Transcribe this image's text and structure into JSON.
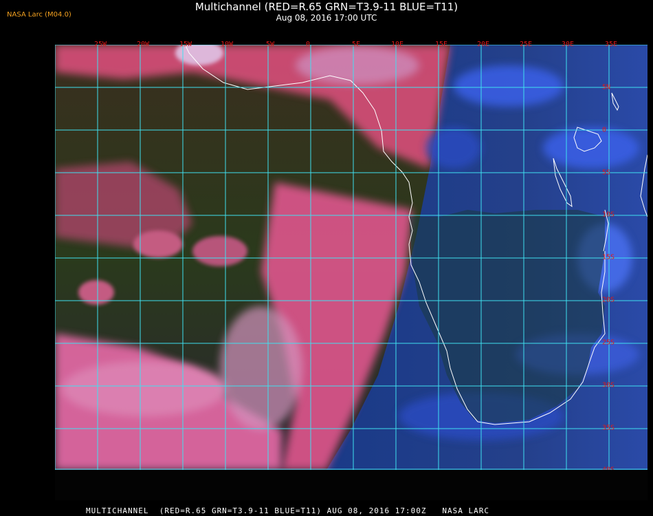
{
  "header": {
    "title": "Multichannel (RED=R.65 GRN=T3.9-11 BLUE=T11)",
    "datetime": "Aug 08, 2016 17:00 UTC"
  },
  "source_label": "NASA Larc (M04.0)",
  "map": {
    "type": "satellite multichannel RGB composite",
    "lon_labels": [
      "25W",
      "20W",
      "15W",
      "10W",
      "5W",
      "0",
      "5E",
      "10E",
      "15E",
      "20E",
      "25E",
      "30E",
      "35E"
    ],
    "lat_labels": [
      "5N",
      "0",
      "5S",
      "10S",
      "15S",
      "20S",
      "25S",
      "30S",
      "35S",
      "40S"
    ],
    "colors": {
      "grid": "#3fe0f0",
      "coastline": "#ffffff",
      "label": "#e01a1a",
      "cloud_pink": "#e85a9a",
      "land_blue": "#2850c8",
      "ocean_dark": "#1e3a20"
    }
  },
  "footer": {
    "caption": "MULTICHANNEL  (RED=R.65 GRN=T3.9-11 BLUE=T11) AUG 08, 2016 17:00Z   NASA LARC"
  }
}
